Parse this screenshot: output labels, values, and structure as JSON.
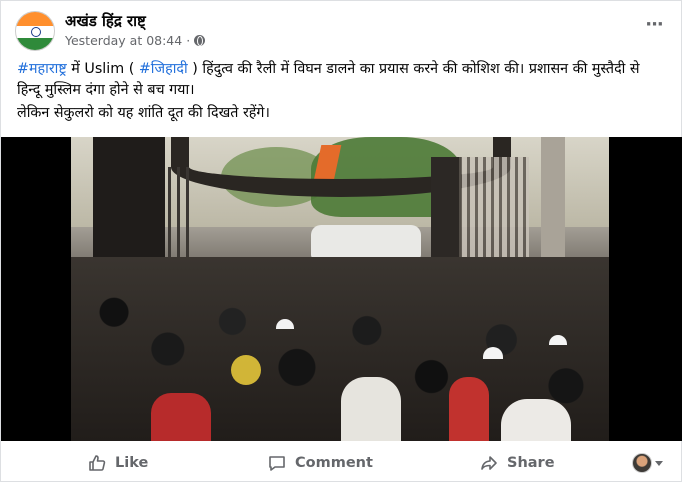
{
  "post": {
    "page_name": "अखंड हिंद्र राष्ट्",
    "timestamp": "Yesterday at 08:44",
    "separator": "·",
    "privacy_icon": "globe-icon",
    "more_icon": "more-options-icon",
    "more_label": "···",
    "text": {
      "hashtag_1": "#महाराष्ट्र",
      "seg_1": " में Uslim ( ",
      "hashtag_2": "#जिहादी",
      "seg_2": " )  हिंदुत्व की रैली में विघन डालने का प्रयास करने की कोशिश की। प्रशासन की मुस्तैदी से हिन्दू मुस्लिम दंगा होने से बच गया।",
      "line_2": "लेकिन सेकुलरो को यह शांति दूत की दिखते रहेंगे।"
    },
    "media": {
      "type": "video",
      "description_icon": "crowd-video-frame"
    }
  },
  "actions": {
    "like": {
      "label": "Like",
      "icon": "thumbs-up-icon"
    },
    "comment": {
      "label": "Comment",
      "icon": "comment-bubble-icon"
    },
    "share": {
      "label": "Share",
      "icon": "share-arrow-icon"
    },
    "profile_selector": {
      "icon": "user-avatar",
      "caret": "chevron-down-icon"
    }
  },
  "colors": {
    "hashtag": "#216fdb",
    "meta_gray": "#65676b",
    "text": "#050505",
    "flag_saffron": "#ff8f2d",
    "flag_green": "#2f8a3a"
  }
}
